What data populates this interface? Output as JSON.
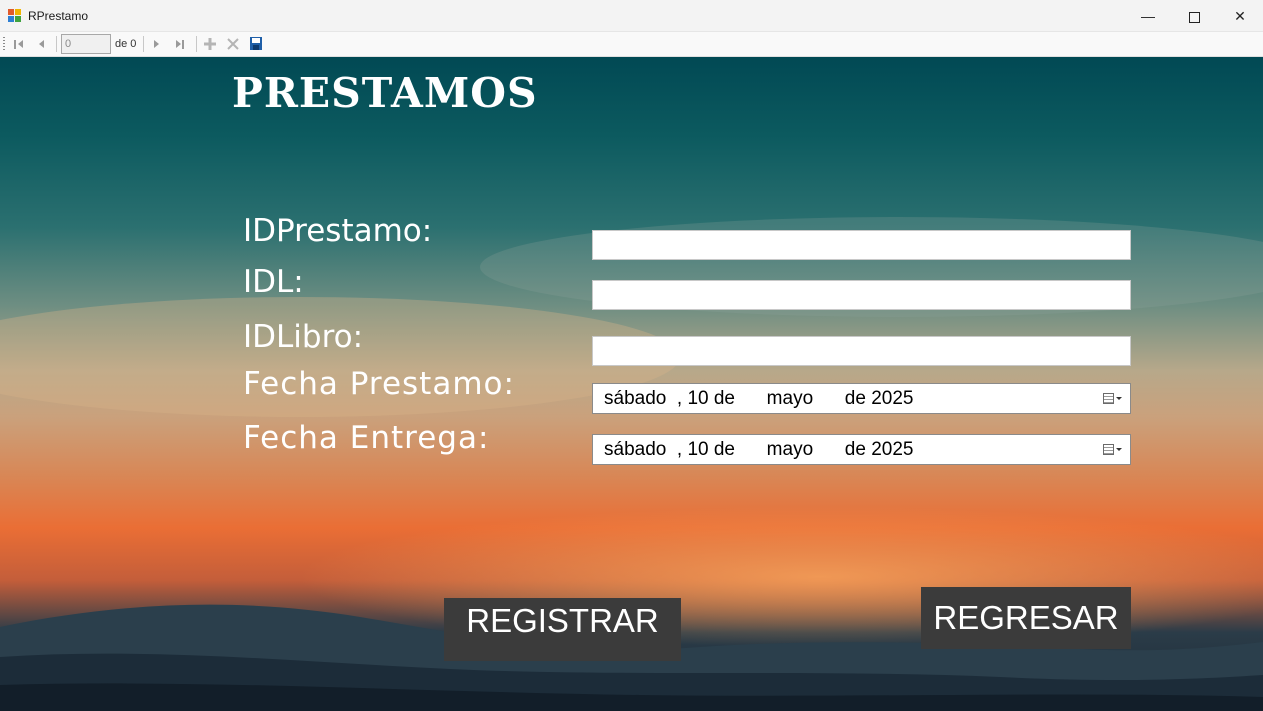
{
  "window": {
    "title": "RPrestamo",
    "controls": {
      "minimize": "—",
      "maximize": "",
      "close": "✕"
    }
  },
  "navigator": {
    "position_value": "0",
    "count_label": "de 0",
    "buttons": [
      "move-first",
      "move-previous",
      "move-next",
      "move-last",
      "add-new",
      "delete",
      "save"
    ]
  },
  "form": {
    "heading": "PRESTAMOS",
    "fields": {
      "id_prestamo": {
        "label": "IDPrestamo:",
        "value": ""
      },
      "idl": {
        "label": "IDL:",
        "value": ""
      },
      "id_libro": {
        "label": "IDLibro:",
        "value": ""
      },
      "fecha_prestamo": {
        "label": "Fecha Prestamo:",
        "value": "sábado  , 10 de      mayo      de 2025"
      },
      "fecha_entrega": {
        "label": "Fecha Entrega:",
        "value": "sábado  , 10 de      mayo      de 2025"
      }
    },
    "buttons": {
      "registrar": "REGISTRAR",
      "regresar": "REGRESAR"
    }
  },
  "colors": {
    "button_bg": "#3b3b3b",
    "sky_top": "#014954",
    "sunset_orange": "#ea6e35",
    "save_icon": "#1f5fa8"
  }
}
